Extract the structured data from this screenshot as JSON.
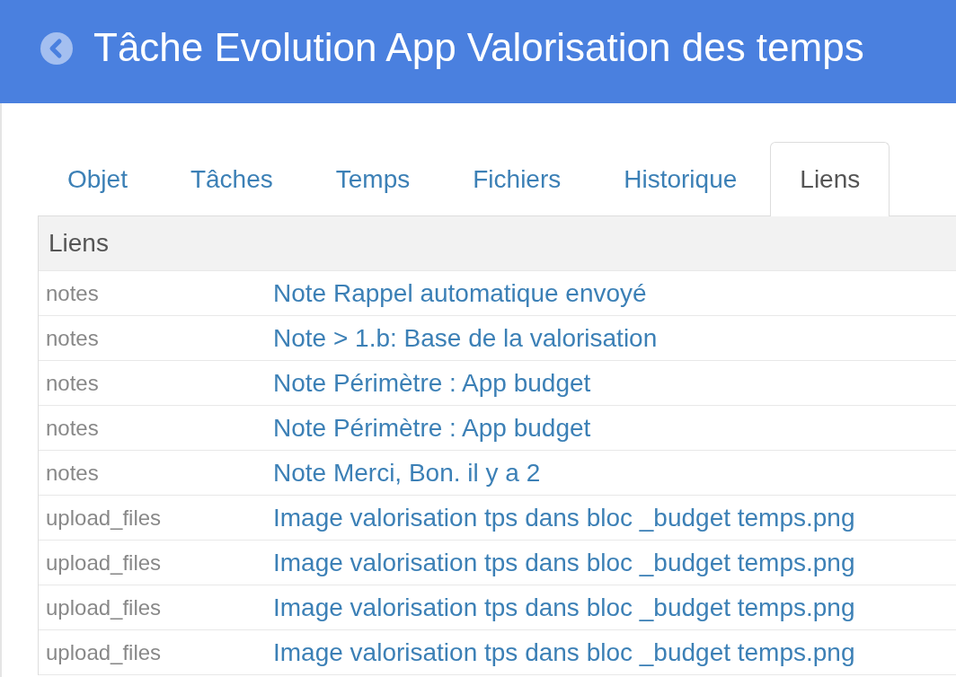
{
  "header": {
    "title": "Tâche Evolution App Valorisation des temps"
  },
  "tabs": [
    {
      "label": "Objet",
      "selected": false
    },
    {
      "label": "Tâches",
      "selected": false
    },
    {
      "label": "Temps",
      "selected": false
    },
    {
      "label": "Fichiers",
      "selected": false
    },
    {
      "label": "Historique",
      "selected": false
    },
    {
      "label": "Liens",
      "selected": true
    }
  ],
  "panel": {
    "heading": "Liens",
    "rows": [
      {
        "column_1": "notes",
        "column_2": "Note Rappel automatique envoyé"
      },
      {
        "column_1": "notes",
        "column_2": "Note > 1.b: Base de la valorisation"
      },
      {
        "column_1": "notes",
        "column_2": "Note Périmètre : App budget"
      },
      {
        "column_1": "notes",
        "column_2": "Note Périmètre : App budget"
      },
      {
        "column_1": "notes",
        "column_2": "Note Merci, Bon. il y a 2"
      },
      {
        "column_1": "upload_files",
        "column_2": "Image valorisation tps dans bloc _budget temps.png"
      },
      {
        "column_1": "upload_files",
        "column_2": "Image valorisation tps dans bloc _budget temps.png"
      },
      {
        "column_1": "upload_files",
        "column_2": "Image valorisation tps dans bloc _budget temps.png"
      },
      {
        "column_1": "upload_files",
        "column_2": "Image valorisation tps dans bloc _budget temps.png"
      }
    ]
  }
}
